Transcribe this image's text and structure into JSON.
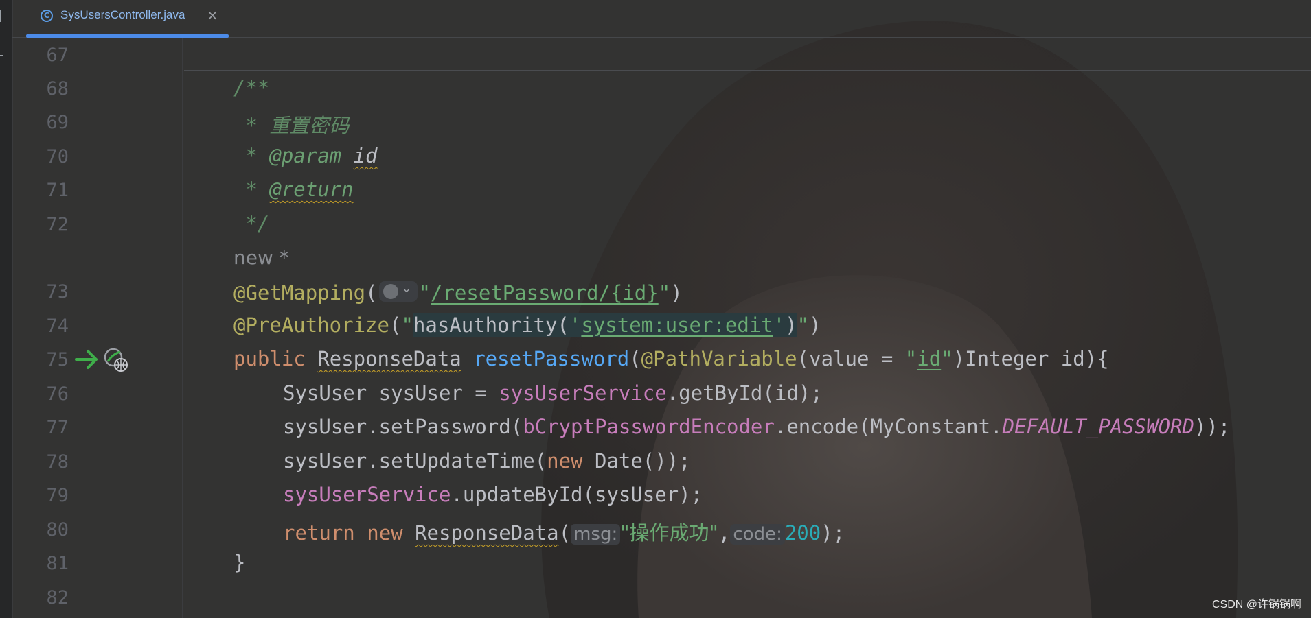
{
  "tab": {
    "icon": "class-icon",
    "icon_glyph": "C",
    "filename": "SysUsersController.java",
    "close_glyph": "×"
  },
  "line_numbers": [
    "67",
    "68",
    "69",
    "70",
    "71",
    "72",
    "73",
    "74",
    "75",
    "76",
    "77",
    "78",
    "79",
    "80",
    "81",
    "82"
  ],
  "code": {
    "doc_open": "/**",
    "doc_star": " * ",
    "doc_desc": "重置密码",
    "doc_param_tag": "@param",
    "doc_param_name": "id",
    "doc_return_tag": "@return",
    "doc_close": " */",
    "author_hint": "new *",
    "getmapping": "@GetMapping",
    "getmapping_path": "/resetPassword/{id}",
    "preauthorize": "@PreAuthorize",
    "preauth_expr_start": "hasAuthority(",
    "preauth_perm": "system:user:edit",
    "preauth_expr_end": ")",
    "kw_public": "public",
    "return_type": "ResponseData",
    "method_name": "resetPassword",
    "pathvariable": "@PathVariable",
    "pv_args": "(value = ",
    "pv_value": "id",
    "param_rest": ")Integer id){",
    "l76_a": "SysUser sysUser = ",
    "l76_field": "sysUserService",
    "l76_b": ".getById(id);",
    "l77_a": "sysUser.setPassword(",
    "l77_field": "bCryptPasswordEncoder",
    "l77_b": ".encode(MyConstant.",
    "l77_const": "DEFAULT_PASSWORD",
    "l77_c": "));",
    "l78_a": "sysUser.setUpdateTime(",
    "l78_kw": "new",
    "l78_b": " Date());",
    "l79_field": "sysUserService",
    "l79_b": ".updateById(sysUser);",
    "l80_kw_return": "return",
    "l80_kw_new": "new",
    "l80_class": "ResponseData",
    "hint_msg": "msg:",
    "l80_str": "\"操作成功\"",
    "hint_code": "code:",
    "l80_num": "200",
    "l80_end": ");",
    "close_brace": "}"
  },
  "gutter_icons": [
    "run-arrow-icon",
    "endpoint-globe-icon"
  ],
  "watermark": "CSDN @许锅锅啊"
}
